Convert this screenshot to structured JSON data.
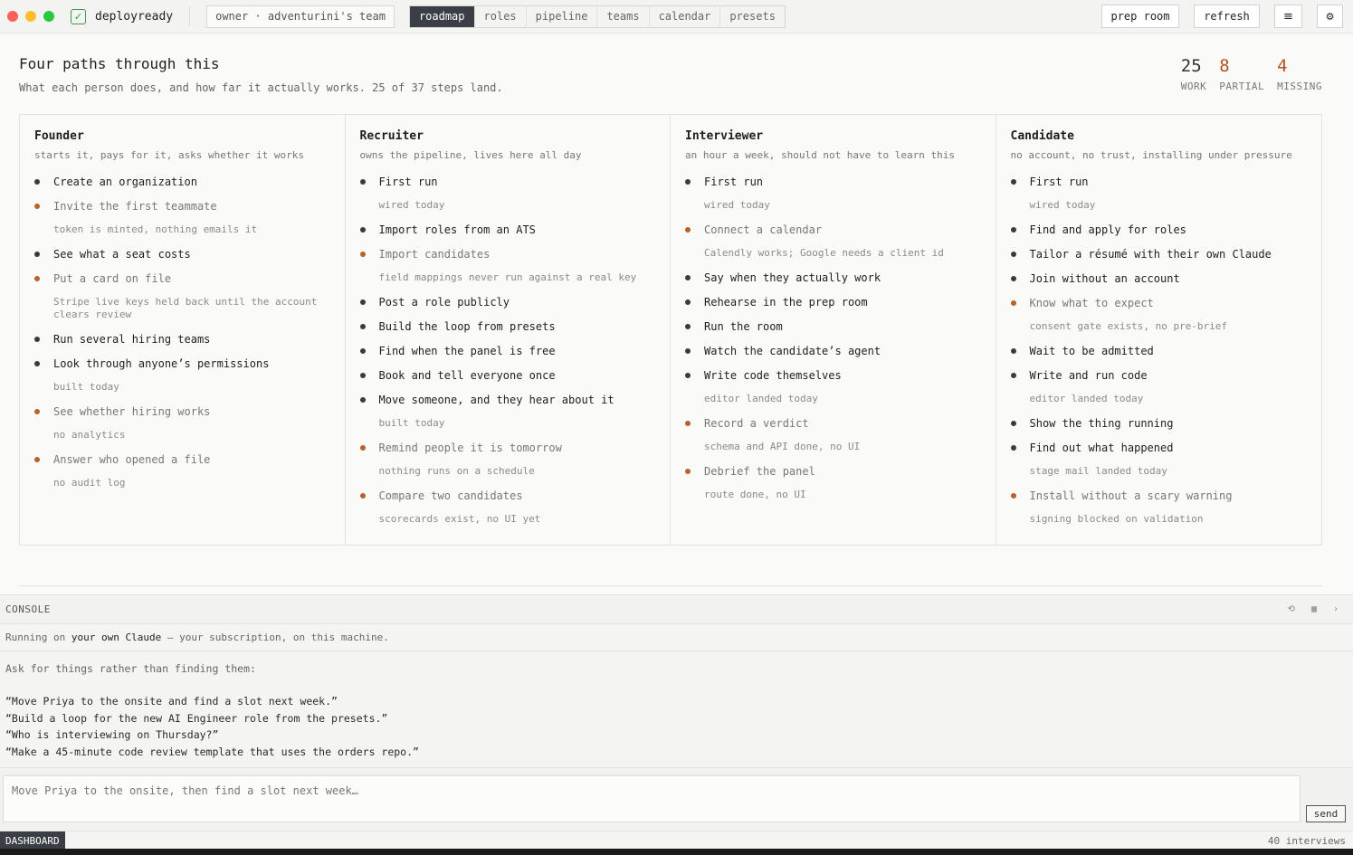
{
  "window": {
    "app_name": "deployready",
    "owner_chip": "owner · adventurini's team",
    "tabs": [
      "roadmap",
      "roles",
      "pipeline",
      "teams",
      "calendar",
      "presets"
    ],
    "active_tab": "roadmap",
    "buttons": {
      "prep_room": "prep room",
      "refresh": "refresh",
      "menu": "≡",
      "settings": "⚙"
    }
  },
  "header": {
    "title": "Four paths through this",
    "subtitle": "What each person does, and how far it actually works. 25 of 37 steps land."
  },
  "stats": [
    {
      "value": "25",
      "label": "WORK",
      "color": "#333333"
    },
    {
      "value": "8",
      "label": "PARTIAL",
      "color": "#b3531f"
    },
    {
      "value": "4",
      "label": "MISSING",
      "color": "#b3531f"
    }
  ],
  "colors": {
    "work_bullet": "#3a3a3a",
    "partial_bullet": "#b8622a"
  },
  "columns": [
    {
      "title": "Founder",
      "subtitle": "starts it, pays for it, asks whether it works",
      "items": [
        {
          "label": "Create an organization",
          "status": "work"
        },
        {
          "label": "Invite the first teammate",
          "status": "partial",
          "note": "token is minted, nothing emails it"
        },
        {
          "label": "See what a seat costs",
          "status": "work"
        },
        {
          "label": "Put a card on file",
          "status": "partial",
          "note": "Stripe live keys held back until the account clears review"
        },
        {
          "label": "Run several hiring teams",
          "status": "work"
        },
        {
          "label": "Look through anyone’s permissions",
          "status": "work",
          "note": "built today"
        },
        {
          "label": "See whether hiring works",
          "status": "partial",
          "note": "no analytics"
        },
        {
          "label": "Answer who opened a file",
          "status": "partial",
          "note": "no audit log"
        }
      ]
    },
    {
      "title": "Recruiter",
      "subtitle": "owns the pipeline, lives here all day",
      "items": [
        {
          "label": "First run",
          "status": "work",
          "note": "wired today"
        },
        {
          "label": "Import roles from an ATS",
          "status": "work"
        },
        {
          "label": "Import candidates",
          "status": "partial",
          "note": "field mappings never run against a real key"
        },
        {
          "label": "Post a role publicly",
          "status": "work"
        },
        {
          "label": "Build the loop from presets",
          "status": "work"
        },
        {
          "label": "Find when the panel is free",
          "status": "work"
        },
        {
          "label": "Book and tell everyone once",
          "status": "work"
        },
        {
          "label": "Move someone, and they hear about it",
          "status": "work",
          "note": "built today"
        },
        {
          "label": "Remind people it is tomorrow",
          "status": "partial",
          "note": "nothing runs on a schedule"
        },
        {
          "label": "Compare two candidates",
          "status": "partial",
          "note": "scorecards exist, no UI yet"
        }
      ]
    },
    {
      "title": "Interviewer",
      "subtitle": "an hour a week, should not have to learn this",
      "items": [
        {
          "label": "First run",
          "status": "work",
          "note": "wired today"
        },
        {
          "label": "Connect a calendar",
          "status": "partial",
          "note": "Calendly works; Google needs a client id"
        },
        {
          "label": "Say when they actually work",
          "status": "work"
        },
        {
          "label": "Rehearse in the prep room",
          "status": "work"
        },
        {
          "label": "Run the room",
          "status": "work"
        },
        {
          "label": "Watch the candidate’s agent",
          "status": "work"
        },
        {
          "label": "Write code themselves",
          "status": "work",
          "note": "editor landed today"
        },
        {
          "label": "Record a verdict",
          "status": "partial",
          "note": "schema and API done, no UI"
        },
        {
          "label": "Debrief the panel",
          "status": "partial",
          "note": "route done, no UI"
        }
      ]
    },
    {
      "title": "Candidate",
      "subtitle": "no account, no trust, installing under pressure",
      "items": [
        {
          "label": "First run",
          "status": "work",
          "note": "wired today"
        },
        {
          "label": "Find and apply for roles",
          "status": "work"
        },
        {
          "label": "Tailor a résumé with their own Claude",
          "status": "work"
        },
        {
          "label": "Join without an account",
          "status": "work"
        },
        {
          "label": "Know what to expect",
          "status": "partial",
          "note": "consent gate exists, no pre-brief"
        },
        {
          "label": "Wait to be admitted",
          "status": "work"
        },
        {
          "label": "Write and run code",
          "status": "work",
          "note": "editor landed today"
        },
        {
          "label": "Show the thing running",
          "status": "work"
        },
        {
          "label": "Find out what happened",
          "status": "work",
          "note": "stage mail landed today"
        },
        {
          "label": "Install without a scary warning",
          "status": "partial",
          "note": "signing blocked on validation"
        }
      ]
    }
  ],
  "console": {
    "title": "CONSOLE",
    "icons": [
      "refresh-icon",
      "grid-icon",
      "chevron-right-icon"
    ],
    "running_prefix": "Running on ",
    "running_strong": "your own Claude",
    "running_suffix": " — your subscription, on this machine.",
    "ask": "Ask for things rather than finding them:",
    "examples": [
      "“Move Priya to the onsite and find a slot next week.”",
      "“Build a loop for the new AI Engineer role from the presets.”",
      "“Who is interviewing on Thursday?”",
      "“Make a 45-minute code review template that uses the orders repo.”"
    ],
    "input_placeholder": "Move Priya to the onsite, then find a slot next week…",
    "send_label": "send"
  },
  "status": {
    "left": "DASHBOARD",
    "right": "40 interviews"
  }
}
